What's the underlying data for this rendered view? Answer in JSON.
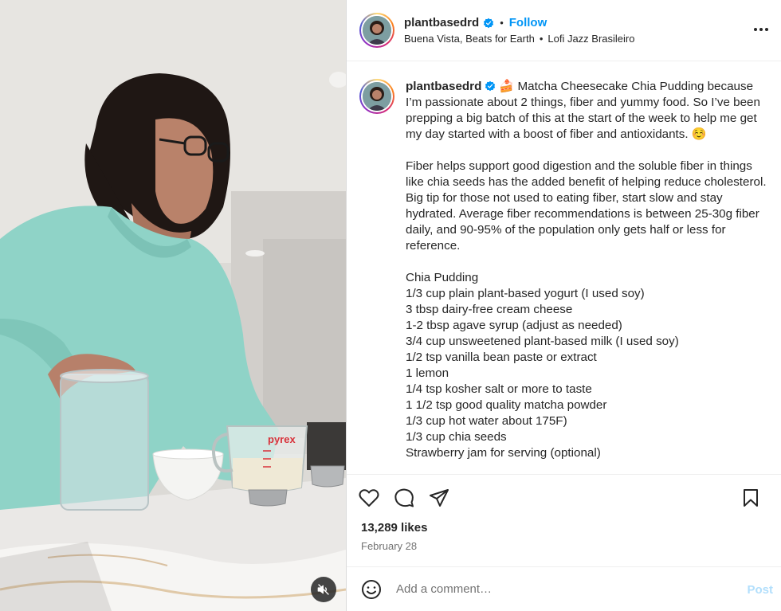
{
  "header": {
    "username": "plantbasedrd",
    "separator": "•",
    "follow_label": "Follow",
    "audio_artist": "Buena Vista, Beats for Earth",
    "audio_bullet": "•",
    "audio_track": "Lofi Jazz Brasileiro",
    "more_icon": "more-horizontal-icon"
  },
  "caption": {
    "username": "plantbasedrd",
    "emoji_cake": "🍰",
    "lines": [
      "Matcha Cheesecake Chia Pudding because I’m passionate about 2 things, fiber and yummy food. So I’ve been prepping a big batch of this at the start of the week to help me get my day started with a boost of fiber and antioxidants. ☺️",
      "",
      "Fiber helps support good digestion and the soluble fiber in things like chia seeds has the added benefit of helping reduce cholesterol. Big tip for those not used to eating fiber, start slow and stay hydrated. Average fiber recommendations is between 25-30g fiber daily, and 90-95% of the population only gets half or less for reference.",
      "",
      "Chia Pudding",
      "1/3 cup plain plant-based yogurt (I used soy)",
      "3 tbsp dairy-free cream cheese",
      "1-2 tbsp agave syrup (adjust as needed)",
      "3/4 cup unsweetened plant-based milk (I used soy)",
      "1/2 tsp vanilla bean paste or extract",
      "1 lemon",
      "1/4 tsp kosher salt or more to taste",
      "1 1/2 tsp good quality matcha powder",
      "1/3 cup hot water about 175F)",
      "1/3 cup chia seeds",
      "Strawberry jam for serving (optional)"
    ]
  },
  "actions": {
    "icons": [
      "heart-icon",
      "comment-icon",
      "share-icon",
      "bookmark-icon"
    ]
  },
  "stats": {
    "likes": "13,289 likes",
    "date": "February 28"
  },
  "comment": {
    "placeholder": "Add a comment…",
    "post_label": "Post"
  },
  "media": {
    "mute_icon": "volume-muted-icon",
    "jar_brand": "pyrex"
  },
  "colors": {
    "accent": "#0095f6",
    "post_disabled": "#b2dffc",
    "verified": "#0095f6",
    "sweater": "#8fd3c7"
  }
}
